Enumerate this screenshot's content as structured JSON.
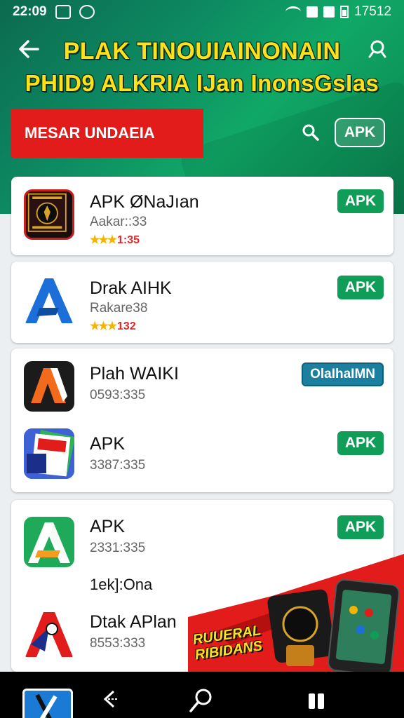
{
  "status_bar": {
    "time": "22:09",
    "right_text": "17512"
  },
  "header": {
    "line1": "PLAK TINOUIAINONAIN",
    "line2": "PHID9 ALKRIA IJan InonsGsIas",
    "banner_label": "MESAR UNDAEIA",
    "apk_button": "APK"
  },
  "apps": [
    {
      "title": "APK ØNaJıan",
      "sub": "Aakar::33",
      "rating": "1:35",
      "button": "APK",
      "icon": "emblem-icon"
    },
    {
      "title": "Drak AIHK",
      "sub": "Rakare38",
      "rating": "132",
      "button": "APK",
      "icon": "blue-a-icon"
    },
    {
      "title": "Plah WAIKI",
      "sub": "0593:335",
      "button": "OlaIhaIMN",
      "icon": "orange-a-icon"
    },
    {
      "title": "APK",
      "sub": "3387:335",
      "button": "APK",
      "icon": "card-stack-icon"
    },
    {
      "title": "APK",
      "sub": "2331:335",
      "extra": "1ek]:Ona",
      "button": "APK",
      "icon": "green-a-icon"
    },
    {
      "title": "Dtak APlan",
      "sub": "8553:333",
      "icon": "red-a-icon"
    }
  ],
  "promo": {
    "text": "RUUERAL RIBIDANS"
  },
  "colors": {
    "accent": "#0f9d58",
    "banner": "#e21b1b",
    "headline": "#ffe11a"
  }
}
